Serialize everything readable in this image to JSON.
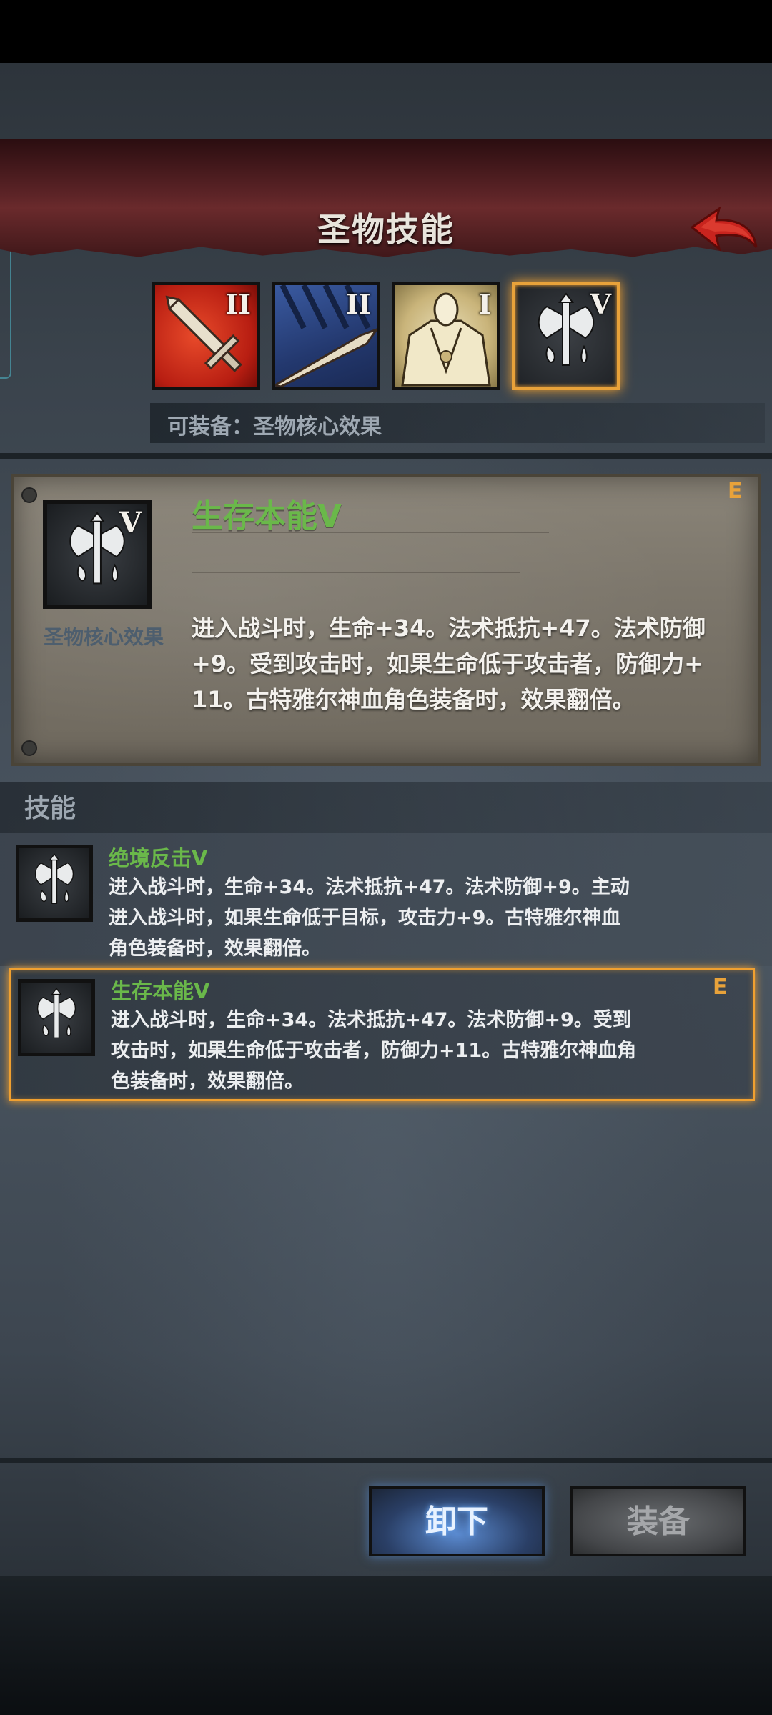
{
  "header": {
    "title": "圣物技能"
  },
  "relic_slots": [
    {
      "numeral": "II",
      "color": "#c6281a",
      "icon": "sword-icon"
    },
    {
      "numeral": "II",
      "color": "#2b437d",
      "icon": "spear-icon"
    },
    {
      "numeral": "I",
      "color": "#d9c891",
      "icon": "armor-icon"
    },
    {
      "numeral": "V",
      "color": "#2a2d31",
      "icon": "axe-blood-icon",
      "selected": true
    }
  ],
  "equip_hint": "可装备：圣物核心效果",
  "core": {
    "numeral": "V",
    "label": "圣物核心效果",
    "rank": "E",
    "name": "生存本能V",
    "description": "进入战斗时，生命+34。法术抵抗+47。法术防御+9。受到攻击时，如果生命低于攻击者，防御力+11。古特雅尔神血角色装备时，效果翻倍。"
  },
  "skills_section": {
    "title": "技能",
    "items": [
      {
        "name": "绝境反击V",
        "description": "进入战斗时，生命+34。法术抵抗+47。法术防御+9。主动进入战斗时，如果生命低于目标，攻击力+9。古特雅尔神血角色装备时，效果翻倍。",
        "rank": ""
      },
      {
        "name": "生存本能V",
        "description": "进入战斗时，生命+34。法术抵抗+47。法术防御+9。受到攻击时，如果生命低于攻击者，防御力+11。古特雅尔神血角色装备时，效果翻倍。",
        "rank": "E",
        "selected": true
      }
    ]
  },
  "buttons": {
    "unequip": "卸下",
    "equip": "装备"
  },
  "colors": {
    "accent_orange": "#f0a030",
    "skill_green": "#6ab84a",
    "title_red": "#5d2427"
  }
}
